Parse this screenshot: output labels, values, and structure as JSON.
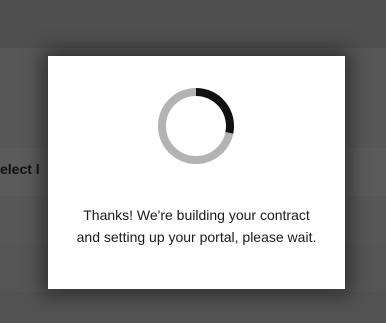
{
  "background": {
    "partial_label": "elect l"
  },
  "modal": {
    "message_line1": "Thanks! We're building your contract",
    "message_line2": "and setting up your portal, please wait.",
    "spinner": {
      "icon": "loading-spinner-icon",
      "track_color": "#b3b3b3",
      "arc_color": "#111111"
    }
  },
  "colors": {
    "overlay": "#5a5a5a",
    "modal_bg": "#ffffff",
    "text": "#1a1a1a"
  }
}
